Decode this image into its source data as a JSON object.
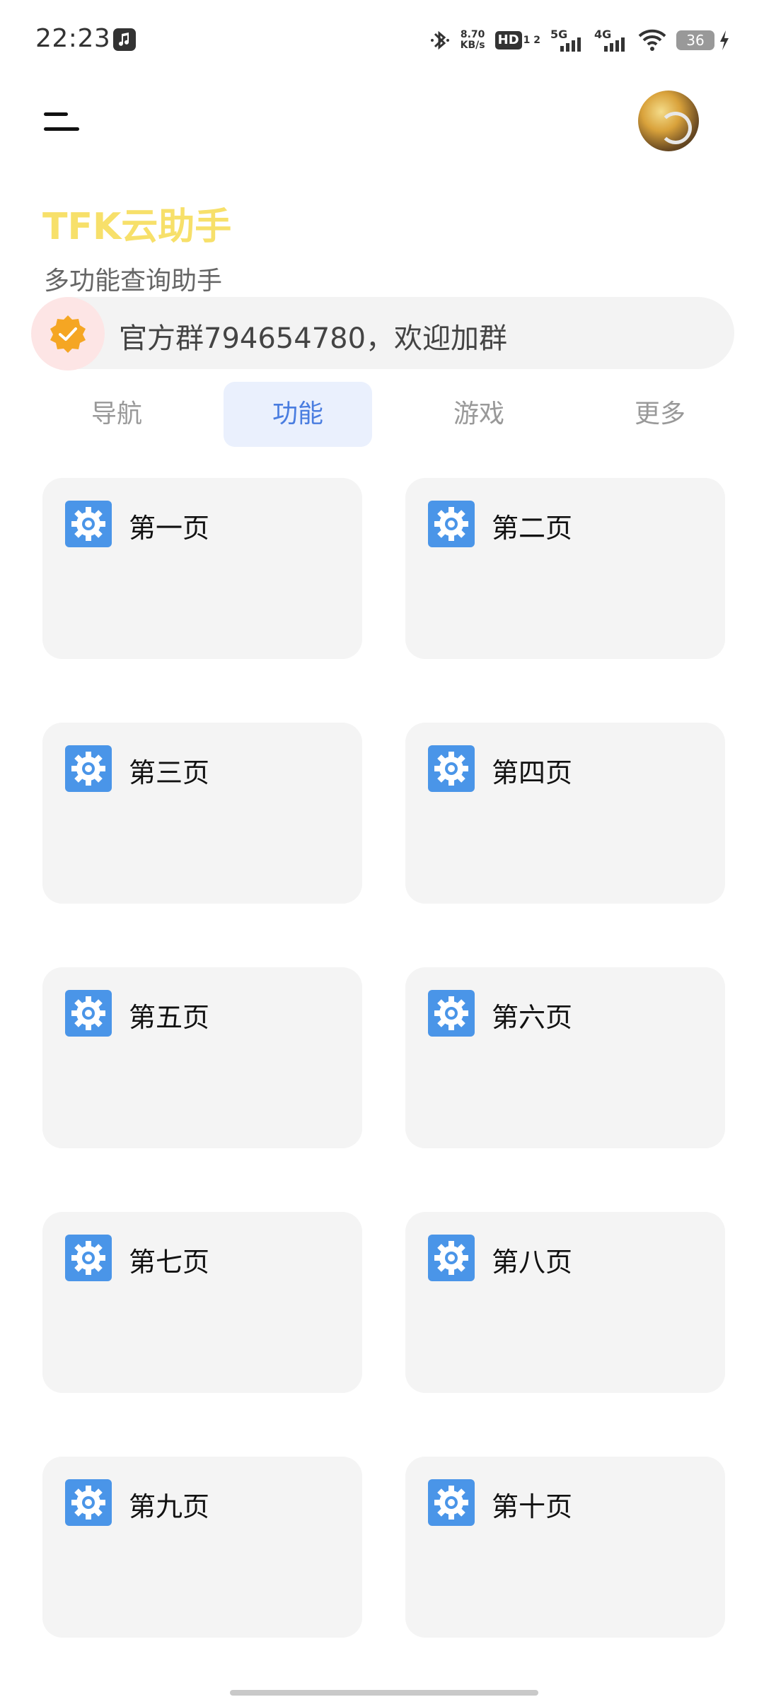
{
  "status_bar": {
    "time": "22:23",
    "net_speed_value": "8.70",
    "net_speed_unit": "KB/s",
    "hd_label": "HD",
    "hd_sub": "1 2",
    "signal1_label": "5G",
    "signal2_label": "4G",
    "battery": "36"
  },
  "header": {
    "title": "TFK云助手",
    "subtitle": "多功能查询助手"
  },
  "notice": {
    "text": "官方群794654780，欢迎加群"
  },
  "tabs": [
    {
      "label": "导航",
      "active": false
    },
    {
      "label": "功能",
      "active": true
    },
    {
      "label": "游戏",
      "active": false
    },
    {
      "label": "更多",
      "active": false
    }
  ],
  "cards": [
    {
      "label": "第一页"
    },
    {
      "label": "第二页"
    },
    {
      "label": "第三页"
    },
    {
      "label": "第四页"
    },
    {
      "label": "第五页"
    },
    {
      "label": "第六页"
    },
    {
      "label": "第七页"
    },
    {
      "label": "第八页"
    },
    {
      "label": "第九页"
    },
    {
      "label": "第十页"
    }
  ],
  "colors": {
    "title": "#f7e06a",
    "active_tab_bg": "#eaf0fd",
    "active_tab_text": "#4a7de0",
    "card_icon": "#4a95e8",
    "notice_badge": "#f5a623"
  },
  "icons": {
    "card": "settings-gear-icon",
    "notice": "verified-badge-icon",
    "menu": "menu-icon"
  }
}
